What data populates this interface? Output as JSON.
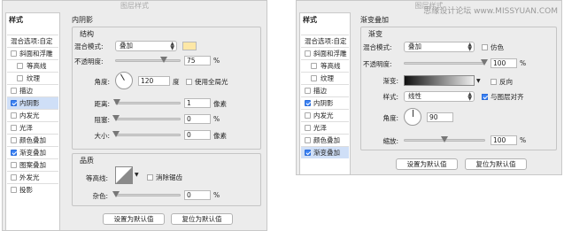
{
  "left": {
    "title": "图层样式",
    "sidebar": {
      "header": "样式",
      "blend_item": "混合选项:自定",
      "items": [
        {
          "label": "斜面和浮雕",
          "checked": false
        },
        {
          "label": "等高线",
          "checked": false
        },
        {
          "label": "纹理",
          "checked": false
        },
        {
          "label": "描边",
          "checked": false
        },
        {
          "label": "内阴影",
          "checked": true
        },
        {
          "label": "内发光",
          "checked": false
        },
        {
          "label": "光泽",
          "checked": false
        },
        {
          "label": "颜色叠加",
          "checked": false
        },
        {
          "label": "渐变叠加",
          "checked": true
        },
        {
          "label": "图案叠加",
          "checked": false
        },
        {
          "label": "外发光",
          "checked": false
        },
        {
          "label": "投影",
          "checked": false
        }
      ]
    },
    "section_title": "内阴影",
    "structure": {
      "title": "结构",
      "blend_mode_label": "混合模式:",
      "blend_mode_value": "叠加",
      "swatch_color": "#fde7a6",
      "opacity_label": "不透明度:",
      "opacity_value": "75",
      "opacity_unit": "%",
      "opacity_level": 75,
      "angle_label": "角度:",
      "angle_value": "120",
      "angle_unit": "度",
      "global_light_label": "使用全局光",
      "distance_label": "距离:",
      "distance_value": "1",
      "distance_unit": "像素",
      "choke_label": "阻塞:",
      "choke_value": "0",
      "choke_unit": "%",
      "size_label": "大小:",
      "size_value": "0",
      "size_unit": "像素"
    },
    "quality": {
      "title": "品质",
      "contour_label": "等高线:",
      "antialias_label": "消除锯齿",
      "noise_label": "杂色:",
      "noise_value": "0",
      "noise_unit": "%"
    },
    "default_button": "设置为默认值",
    "reset_button": "复位为默认值"
  },
  "right": {
    "title": "图层样式",
    "watermark": "思缘设计论坛 www.MISSYUAN.COM",
    "sidebar": {
      "header": "样式",
      "blend_item": "混合选项:自定",
      "items": [
        {
          "label": "斜面和浮雕",
          "checked": false
        },
        {
          "label": "等高线",
          "checked": false
        },
        {
          "label": "纹理",
          "checked": false
        },
        {
          "label": "描边",
          "checked": false
        },
        {
          "label": "内阴影",
          "checked": true
        },
        {
          "label": "内发光",
          "checked": false
        },
        {
          "label": "光泽",
          "checked": false
        },
        {
          "label": "颜色叠加",
          "checked": false
        },
        {
          "label": "渐变叠加",
          "checked": true
        }
      ]
    },
    "section_title": "渐变叠加",
    "gradient": {
      "title": "渐变",
      "blend_mode_label": "混合模式:",
      "blend_mode_value": "叠加",
      "dither_label": "仿色",
      "opacity_label": "不透明度:",
      "opacity_value": "100",
      "opacity_unit": "%",
      "opacity_level": 100,
      "gradient_label": "渐变:",
      "reverse_label": "反向",
      "style_label": "样式:",
      "style_value": "线性",
      "align_label": "与图层对齐",
      "angle_label": "角度:",
      "angle_value": "90",
      "scale_label": "缩放:",
      "scale_value": "100",
      "scale_unit": "%",
      "scale_level": 100
    },
    "default_button": "设置为默认值",
    "reset_button": "复位为默认值"
  }
}
